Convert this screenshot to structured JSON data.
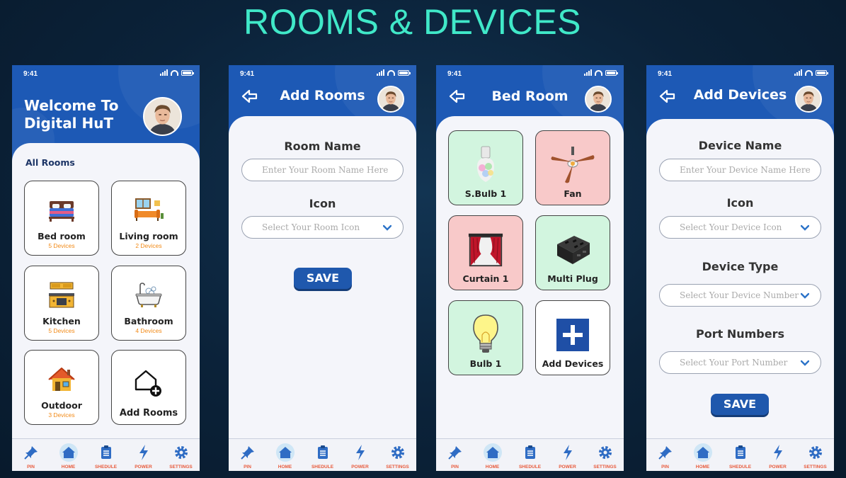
{
  "title": "ROOMS & DEVICES",
  "status_time": "9:41",
  "nav": [
    "PIN",
    "HOME",
    "SHEDULE",
    "POWER",
    "SETTINGS"
  ],
  "screens": {
    "home": {
      "welcome_line1": "Welcome To",
      "welcome_line2": "Digital HuT",
      "section": "All Rooms",
      "rooms": [
        {
          "name": "Bed room",
          "count": "5 Devices",
          "icon": "bed-icon"
        },
        {
          "name": "Living room",
          "count": "2 Devices",
          "icon": "living-room-icon"
        },
        {
          "name": "Kitchen",
          "count": "5 Devices",
          "icon": "kitchen-icon"
        },
        {
          "name": "Bathroom",
          "count": "4 Devices",
          "icon": "bathtub-icon"
        },
        {
          "name": "Outdoor",
          "count": "3 Devices",
          "icon": "house-icon"
        },
        {
          "name": "Add Rooms",
          "count": "",
          "icon": "add-home-icon"
        }
      ]
    },
    "add_rooms": {
      "header": "Add Rooms",
      "room_name_label": "Room Name",
      "room_name_placeholder": "Enter Your Room Name Here",
      "icon_label": "Icon",
      "icon_placeholder": "Select Your Room Icon",
      "save": "SAVE"
    },
    "bed_room": {
      "header": "Bed Room",
      "devices": [
        {
          "name": "S.Bulb 1",
          "state": "on",
          "icon": "smart-bulb-icon"
        },
        {
          "name": "Fan",
          "state": "off",
          "icon": "ceiling-fan-icon"
        },
        {
          "name": "Curtain 1",
          "state": "off",
          "icon": "curtain-icon"
        },
        {
          "name": "Multi Plug",
          "state": "on",
          "icon": "multi-plug-icon"
        },
        {
          "name": "Bulb 1",
          "state": "on",
          "icon": "bulb-icon"
        },
        {
          "name": "Add Devices",
          "state": "none",
          "icon": "plus-icon"
        }
      ]
    },
    "add_devices": {
      "header": "Add Devices",
      "device_name_label": "Device Name",
      "device_name_placeholder": "Enter Your Device Name Here",
      "icon_label": "Icon",
      "icon_placeholder": "Select Your Device Icon",
      "device_type_label": "Device Type",
      "device_type_placeholder": "Select Your Device Number",
      "port_label": "Port Numbers",
      "port_placeholder": "Select Your Port Number",
      "save": "SAVE"
    }
  },
  "colors": {
    "accent": "#1d59b5",
    "title": "#40e8c8",
    "on": "#d2f5df",
    "off": "#f8c9c9",
    "count": "#f28a17"
  }
}
